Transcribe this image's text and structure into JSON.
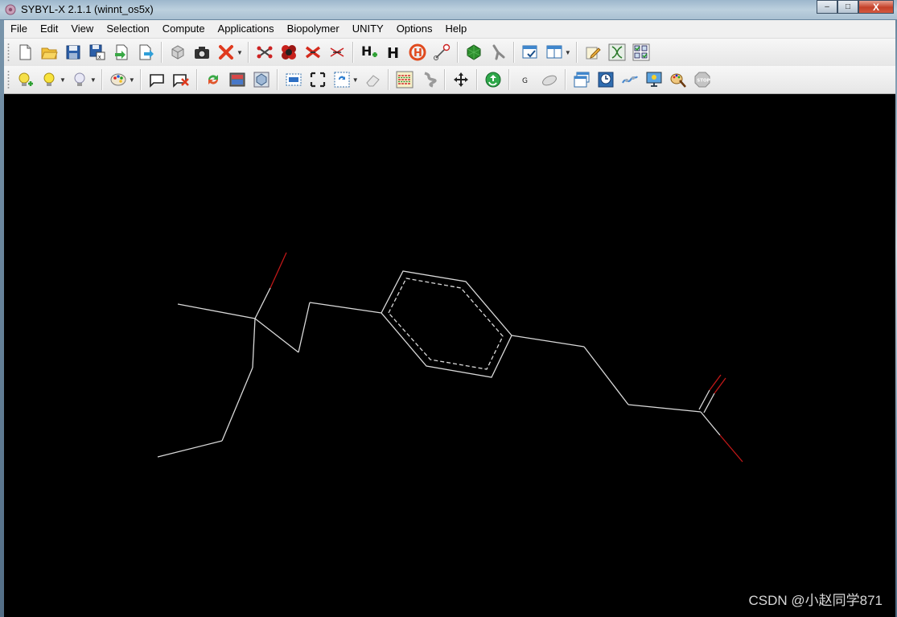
{
  "window": {
    "title": "SYBYL-X 2.1.1 (winnt_os5x)",
    "controls": {
      "minimize": "–",
      "maximize": "□",
      "close": "X"
    }
  },
  "menu": {
    "items": [
      "File",
      "Edit",
      "View",
      "Selection",
      "Compute",
      "Applications",
      "Biopolymer",
      "UNITY",
      "Options",
      "Help"
    ]
  },
  "toolbar1": {
    "icons": [
      "new-file-icon",
      "open-folder-icon",
      "save-icon",
      "save-as-icon",
      "import-icon",
      "export-icon",
      "molecule-box-icon",
      "camera-icon",
      "delete-icon",
      "bond-atoms-icon",
      "spacefill-icon",
      "break-bond-icon",
      "cut-bond-icon",
      "add-hydrogens-icon",
      "hydrogen-icon",
      "no-hydrogen-icon",
      "measure-icon",
      "surface-icon",
      "tool-icon",
      "window-check-icon",
      "window-layout-icon",
      "edit-note-icon",
      "dna-icon",
      "checklist-icon"
    ]
  },
  "toolbar2": {
    "icons": [
      "light-add-icon",
      "light-icon",
      "light-dim-icon",
      "palette-icon",
      "label-icon",
      "label-delete-icon",
      "refresh-icon",
      "display-icon",
      "rotate-icon",
      "select-box-icon",
      "fit-icon",
      "zoom-icon",
      "eraser-icon",
      "sequence-icon",
      "protein-icon",
      "move-icon",
      "recycle-icon",
      "g-icon",
      "mouse-icon",
      "windows-icon",
      "clock-icon",
      "link-icon",
      "monitor-icon",
      "paint-icon",
      "stop-icon"
    ],
    "g_label": "G",
    "stop_label": "STOP"
  },
  "viewport": {
    "background": "#000000",
    "bond_color": "#d9d9d9",
    "oxygen_color": "#c01818",
    "watermark": "CSDN @小赵同学871"
  }
}
